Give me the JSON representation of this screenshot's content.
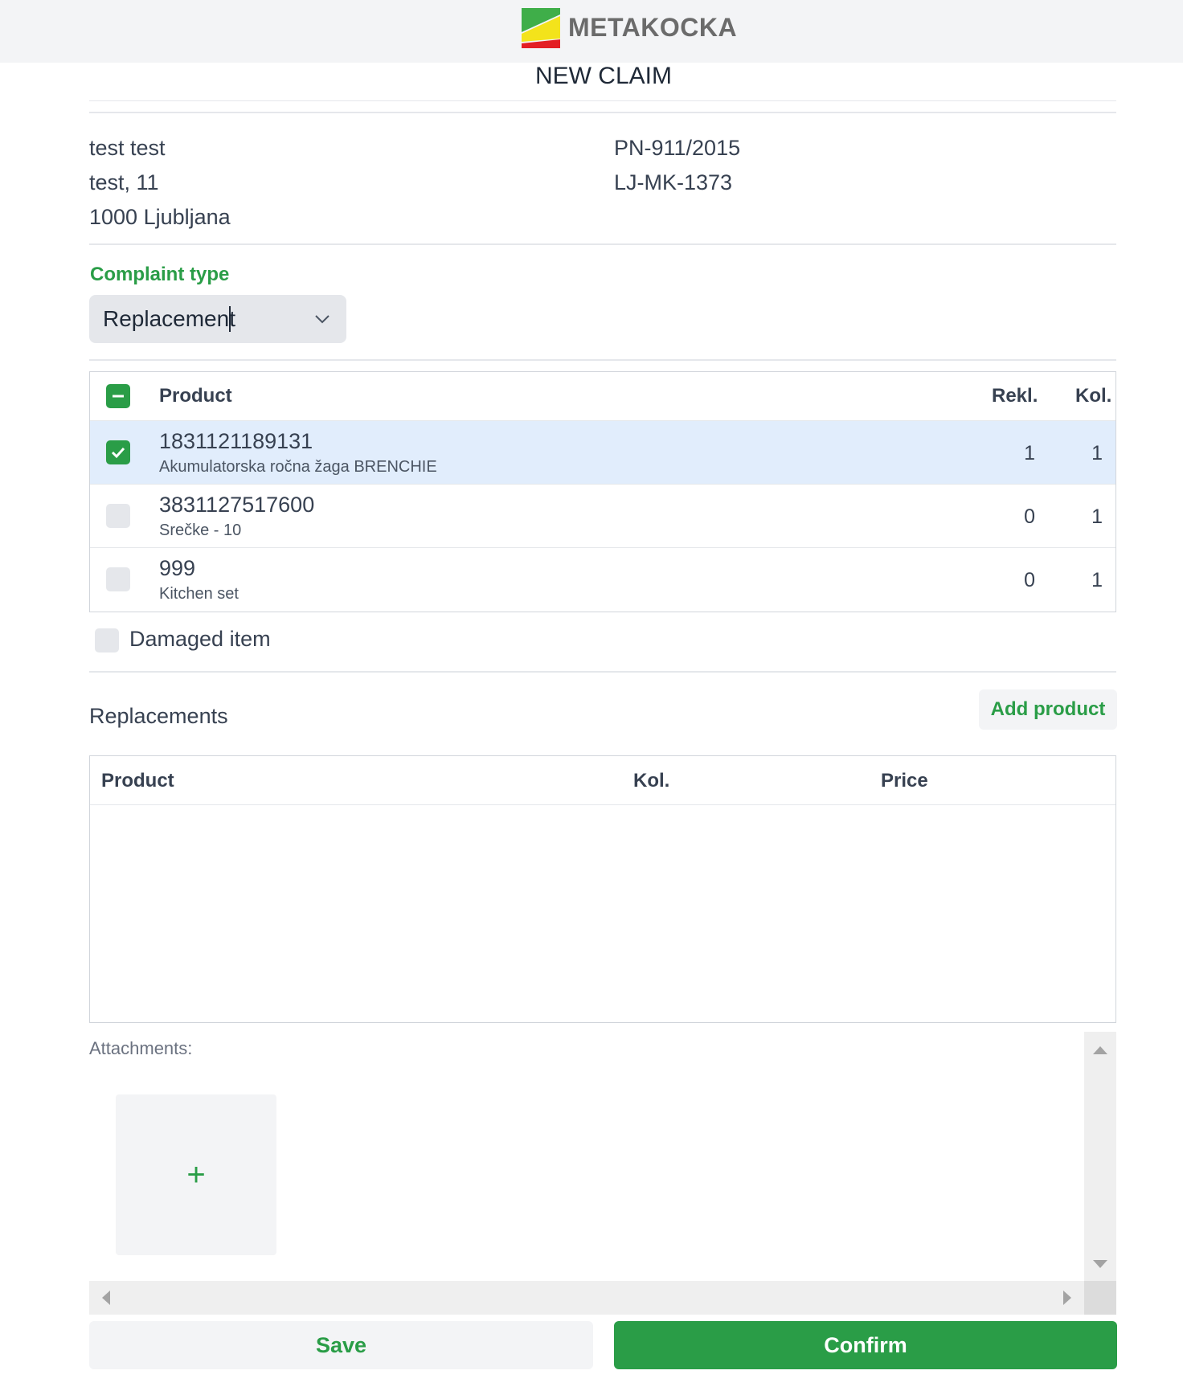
{
  "header": {
    "logo_text": "METAKOCKA",
    "logo_colors": [
      "#3fae49",
      "#f3e31b",
      "#e31e24"
    ]
  },
  "page_title": "NEW CLAIM",
  "customer": {
    "name": "test test",
    "address": "test, 11",
    "city": "1000 Ljubljana"
  },
  "document": {
    "number": "PN-911/2015",
    "code": "LJ-MK-1373"
  },
  "complaint_type": {
    "label": "Complaint type",
    "value": "Replacement"
  },
  "products_table": {
    "headers": {
      "product": "Product",
      "rekl": "Rekl.",
      "kol": "Kol."
    },
    "select_all_state": "indeterminate",
    "rows": [
      {
        "checked": true,
        "code": "1831121189131",
        "name": "Akumulatorska ročna žaga BRENCHIE",
        "rekl": "1",
        "kol": "1"
      },
      {
        "checked": false,
        "code": "3831127517600",
        "name": "Srečke - 10",
        "rekl": "0",
        "kol": "1"
      },
      {
        "checked": false,
        "code": "999",
        "name": "Kitchen set",
        "rekl": "0",
        "kol": "1"
      }
    ]
  },
  "damaged_item": {
    "label": "Damaged item",
    "checked": false
  },
  "replacements": {
    "title": "Replacements",
    "add_label": "Add product",
    "headers": {
      "product": "Product",
      "kol": "Kol.",
      "price": "Price"
    },
    "rows": []
  },
  "attachments": {
    "label": "Attachments:",
    "add_symbol": "+"
  },
  "actions": {
    "save_label": "Save",
    "confirm_label": "Confirm"
  },
  "colors": {
    "accent": "#2a9d47",
    "selected_row": "#e1edfc",
    "input_bg": "#e5e7eb"
  }
}
